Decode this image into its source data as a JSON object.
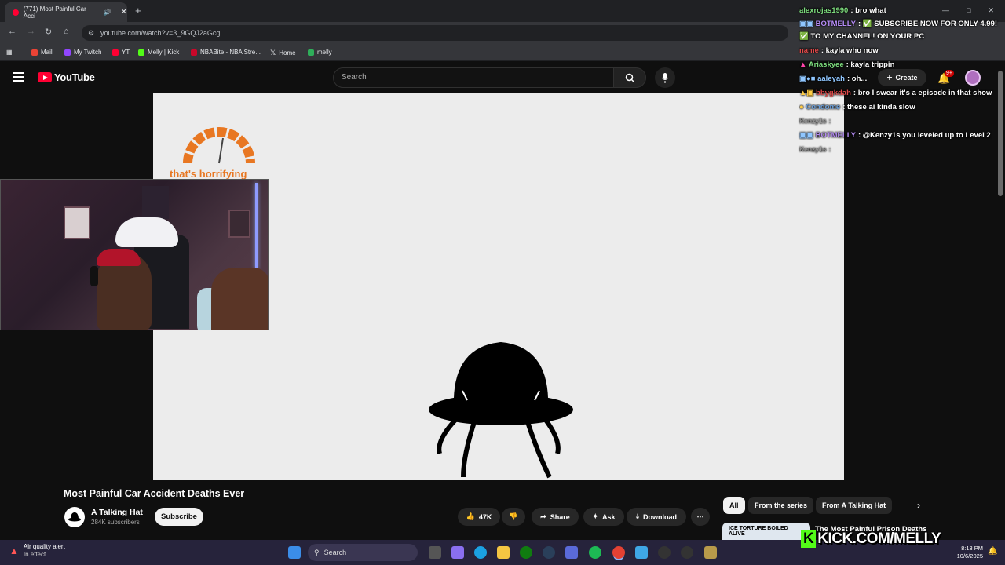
{
  "browser": {
    "tab_title": "(771) Most Painful Car Acci",
    "url": "youtube.com/watch?v=3_9GQJ2aGcg",
    "bookmarks": [
      "Mail",
      "My Twitch",
      "YT",
      "Melly | Kick",
      "NBABite - NBA Stre...",
      "Home",
      "melly"
    ]
  },
  "youtube": {
    "logo": "YouTube",
    "search_placeholder": "Search",
    "create_label": "Create",
    "notif_badge": "9+",
    "video_title": "Most Painful Car Accident Deaths Ever",
    "channel_name": "A Talking Hat",
    "channel_subs": "284K subscribers",
    "subscribe_label": "Subscribe",
    "likes": "47K",
    "share_label": "Share",
    "ask_label": "Ask",
    "download_label": "Download",
    "chips": [
      "All",
      "From the series",
      "From A Talking Hat"
    ],
    "rec_title": "The Most Painful Prison Deaths",
    "rec_thumb_text": "ICE TORTURE   BOILED ALIVE"
  },
  "video_overlay": {
    "gauge_caption": "that's horrifying"
  },
  "chat": [
    {
      "user": "alexrojas1990",
      "msg": ": bro what",
      "color": "#7ddc7d"
    },
    {
      "user": "BOTMELLY",
      "msg": ": ✅ SUBSCRIBE NOW FOR ONLY 4.99!",
      "color": "#b58cf5"
    },
    {
      "user": "",
      "msg": "✅ TO MY CHANNEL! ON YOUR PC",
      "color": "#fff"
    },
    {
      "user": "name",
      "msg": ": kayla who now",
      "color": "#e04a4a"
    },
    {
      "user": "Ariaskyee",
      "msg": ": kayla trippin",
      "color": "#7ddc7d"
    },
    {
      "user": "aaleyah",
      "msg": ": oh...",
      "color": "#8fc6ff"
    },
    {
      "user": "bbygkdah",
      "msg": ": bro I swear it's a episode in that show",
      "color": "#e04a4a"
    },
    {
      "user": "Condome",
      "msg": ": these ai kinda slow",
      "color": "#6a9ed8"
    },
    {
      "user": "Kenzy1s",
      "msg": ":",
      "color": "#999"
    },
    {
      "user": "BOTMELLY",
      "msg": ": @Kenzy1s you leveled up to Level 2",
      "color": "#b58cf5"
    },
    {
      "user": "Kenzy1s",
      "msg": ":",
      "color": "#999"
    }
  ],
  "taskbar": {
    "weather_title": "Air quality alert",
    "weather_sub": "In effect",
    "search_label": "Search",
    "time": "8:13 PM",
    "date": "10/6/2025"
  },
  "stream": {
    "kick_url": "KICK.COM/MELLY",
    "kick_letter": "K"
  }
}
